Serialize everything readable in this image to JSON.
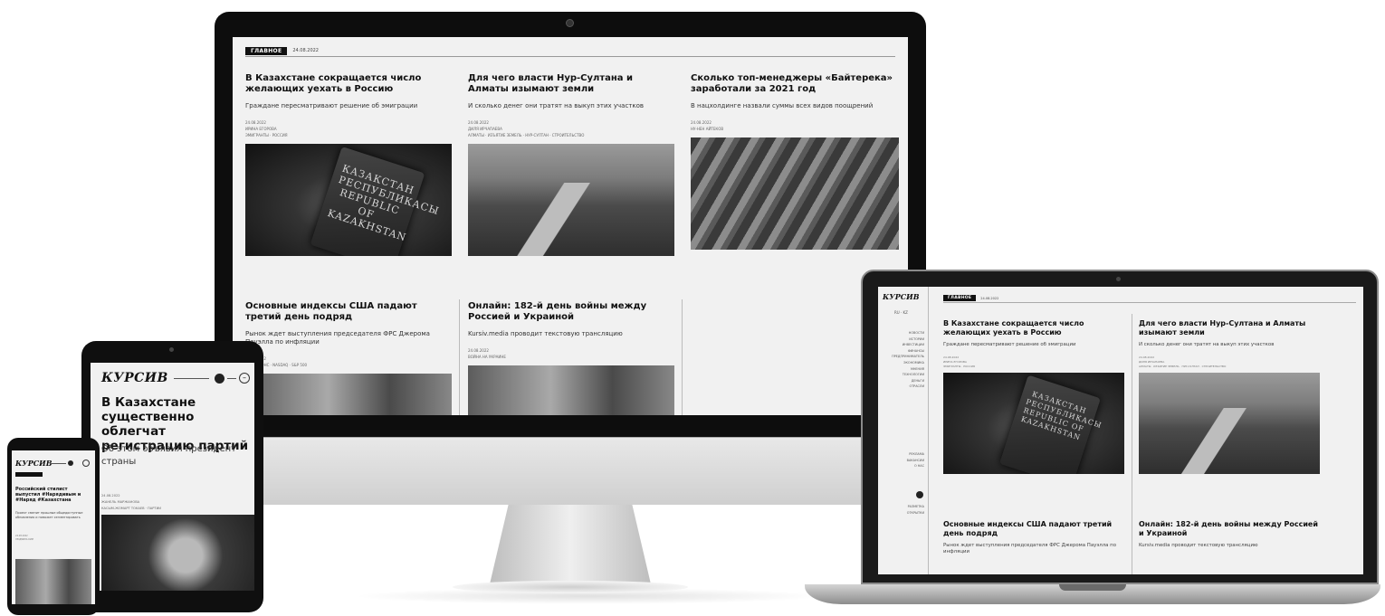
{
  "brand": {
    "logo": "КУРСИВ"
  },
  "section_badge": "ГЛАВНОЕ",
  "section_date": "24.08.2022",
  "desktop_articles": [
    {
      "title": "В Казахстане сокращается число желающих уехать в Россию",
      "lead": "Граждане пересматривают решение об эмиграции",
      "date": "24.08.2022",
      "author": "ИРИНА ЕГОРОВА",
      "tags": "ЭМИГРАНТЫ · РОССИЯ",
      "photo_text": "КАЗАКСТАН РЕСПУБЛИКАСЫ REPUBLIC OF KAZAKHSTAN"
    },
    {
      "title": "Для чего власти Нур-Султана и Алматы изымают земли",
      "lead": "И сколько денег они тратят на выкуп этих участков",
      "date": "24.08.2022",
      "author": "ДИЛЯ ИРЧАПАЕВА",
      "tags": "АЛМАТЫ · ИЗЪЯТИЕ ЗЕМЕЛЬ · НУР-СУЛТАН · СТРОИТЕЛЬСТВО"
    },
    {
      "title": "Сколько топ-менеджеры «Байтерека» заработали за 2021 год",
      "lead": "В нацхолдинге назвали суммы всех видов поощрений",
      "date": "24.08.2022",
      "author": "НУ-НЕН АЙТЕКОВ"
    },
    {
      "title": "Основные индексы США падают третий день подряд",
      "lead": "Рынок ждет выступления председателя ФРС Джерома Пауэлла по инфляции",
      "date": "24.08.2022",
      "tags": "ДОУ ДЖОНС · NASDAQ · S&P 500"
    },
    {
      "title": "Онлайн: 182-й день войны между Россией и Украиной",
      "lead": "Kursiv.media проводит текстовую трансляцию",
      "date": "24.08.2022",
      "author": "ВОЙНА НА УКРАИНЕ"
    }
  ],
  "laptop": {
    "lang": "RU · KZ",
    "menu": [
      "НОВОСТИ",
      "ИСТОРИИ",
      "ИНВЕСТИЦИИ",
      "ФИНАНСЫ",
      "ПРЕДПРИНИМАТЕЛЬ",
      "ЭКОНОМИКА",
      "МНЕНИЯ",
      "ТЕХНОЛОГИИ",
      "ДЕНЬГИ",
      "ОТРАСЛИ"
    ],
    "menu2": [
      "РЕКЛАМА",
      "ВАКАНСИИ",
      "О НАС"
    ],
    "menu3": [
      "РАЗМЕТКА",
      "ОТКРЫТКИ"
    ]
  },
  "tablet_article": {
    "title": "В Казахстане существенно облегчат регистрацию партий",
    "lead": "Об этом объявил президент страны",
    "date": "24.08.2022",
    "author": "ЖАНЕЛЬ МАРЖАНОВА",
    "tags": "КАСЫМ-ЖОМАРТ ТОКАЕВ · ПАРТИИ"
  },
  "phone_article": {
    "title": "Российский стилист выпустил #Нарядивым и #Наряд #Казахстана",
    "lead": "Проект сменит прошлые общедоступные обновления и поможет сегментировать",
    "date": "24.08.2022",
    "author": "ЛЮДМИЛА КИМ"
  }
}
